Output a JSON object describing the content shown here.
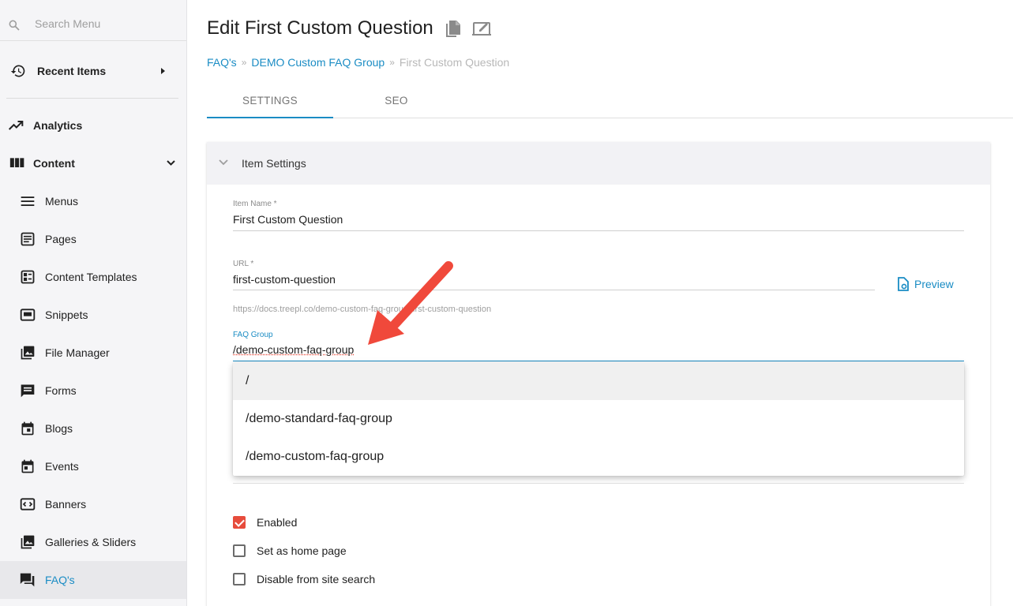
{
  "search": {
    "placeholder": "Search Menu"
  },
  "sidebar": {
    "recent": "Recent Items",
    "analytics": "Analytics",
    "content": "Content",
    "items": [
      "Menus",
      "Pages",
      "Content Templates",
      "Snippets",
      "File Manager",
      "Forms",
      "Blogs",
      "Events",
      "Banners",
      "Galleries & Sliders",
      "FAQ's"
    ]
  },
  "header": {
    "title": "Edit First Custom Question"
  },
  "breadcrumb": {
    "item1": "FAQ's",
    "item2": "DEMO Custom FAQ Group",
    "current": "First Custom Question",
    "sep": "»"
  },
  "tabs": {
    "settings": "SETTINGS",
    "seo": "SEO"
  },
  "panel": {
    "title": "Item Settings"
  },
  "form": {
    "item_name_label": "Item Name *",
    "item_name_value": "First Custom Question",
    "url_label": "URL *",
    "url_value": "first-custom-question",
    "url_hint": "https://docs.treepl.co/demo-custom-faq-group/first-custom-question",
    "preview": "Preview",
    "faq_group_label": "FAQ Group",
    "faq_group_value": "/demo-custom-faq-group"
  },
  "dropdown": {
    "options": [
      "/",
      "/demo-standard-faq-group",
      "/demo-custom-faq-group"
    ]
  },
  "checkboxes": {
    "enabled": "Enabled",
    "home": "Set as home page",
    "disable_search": "Disable from site search"
  },
  "colors": {
    "accent": "#1a8cc4",
    "checkbox": "#e74c3c",
    "arrow": "#f0493b"
  }
}
